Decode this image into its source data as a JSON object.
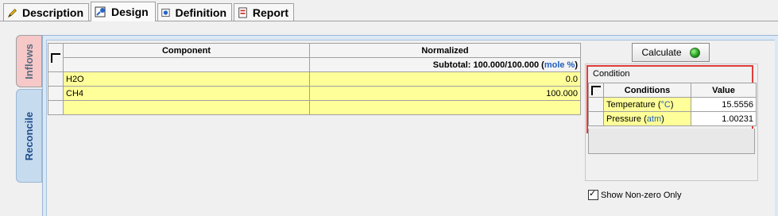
{
  "tabs": [
    {
      "label": "Description",
      "icon": "pencil-icon"
    },
    {
      "label": "Design",
      "icon": "design-icon"
    },
    {
      "label": "Definition",
      "icon": "definition-icon"
    },
    {
      "label": "Report",
      "icon": "report-icon"
    }
  ],
  "side_tabs": {
    "inflows": "Inflows",
    "reconcile": "Reconcile"
  },
  "grid": {
    "headers": {
      "component": "Component",
      "normalized": "Normalized"
    },
    "subtotal_prefix": "Subtotal: 100.000/100.000 (",
    "subtotal_unit": "mole %",
    "subtotal_suffix": ")",
    "rows": [
      {
        "component": "H2O",
        "value": "0.0"
      },
      {
        "component": "CH4",
        "value": "100.000"
      },
      {
        "component": "",
        "value": ""
      }
    ]
  },
  "calculate": {
    "label": "Calculate",
    "status_color": "#2aa52a"
  },
  "condition": {
    "group_title": "Condition",
    "headers": {
      "conditions": "Conditions",
      "value": "Value"
    },
    "rows": [
      {
        "name": "Temperature",
        "unit": "°C",
        "value": "15.5556"
      },
      {
        "name": "Pressure",
        "unit": "atm",
        "value": "1.00231"
      }
    ]
  },
  "show_nonzero": {
    "label": "Show Non-zero Only",
    "checked": true
  },
  "colors": {
    "highlight": "#e03c3c",
    "input_cell": "#ffff99",
    "unit_text": "#1f5fbf"
  }
}
